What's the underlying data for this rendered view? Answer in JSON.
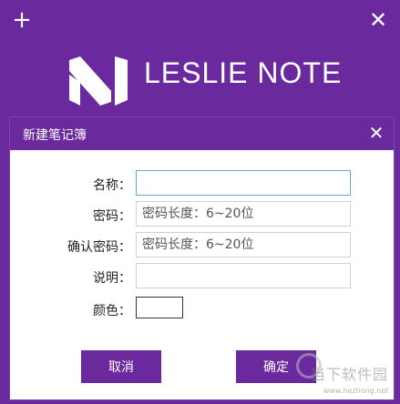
{
  "app": {
    "title": "LESLIE NOTE",
    "add_icon": "+",
    "close_icon": "✕",
    "logo_icon": "leslie-note-logo-icon",
    "brand_color": "#6a2a9e"
  },
  "dialog": {
    "title": "新建笔记簿",
    "close_icon": "✕",
    "fields": {
      "name": {
        "label": "名称：",
        "value": "",
        "placeholder": ""
      },
      "password": {
        "label": "密码：",
        "value": "",
        "placeholder": "密码长度：6~20位"
      },
      "confirm_password": {
        "label": "确认密码：",
        "value": "",
        "placeholder": "密码长度：6~20位"
      },
      "description": {
        "label": "说明：",
        "value": "",
        "placeholder": ""
      },
      "color": {
        "label": "颜色：",
        "value": "#ffffff"
      }
    },
    "buttons": {
      "cancel": "取消",
      "ok": "确定"
    }
  },
  "watermark": {
    "text": "当下软件园",
    "url": "www.hezhong.net"
  }
}
